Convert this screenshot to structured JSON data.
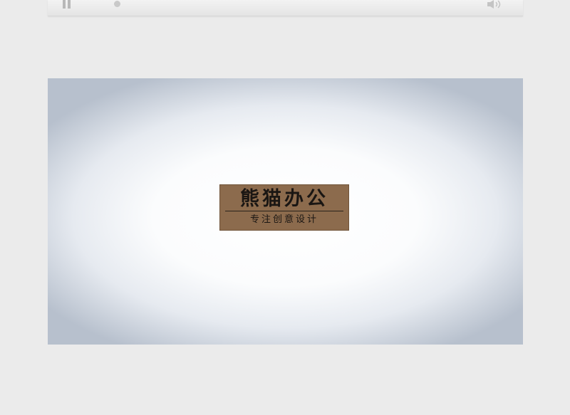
{
  "player": {
    "controls": {
      "pause_icon": "pause-icon",
      "volume_icon": "volume-icon",
      "progress_fraction": 0.0
    }
  },
  "video": {
    "logo": {
      "title": "熊猫办公",
      "subtitle": "专注创意设计",
      "card_color": "#8c6b4d",
      "text_color": "#1a1613"
    }
  }
}
